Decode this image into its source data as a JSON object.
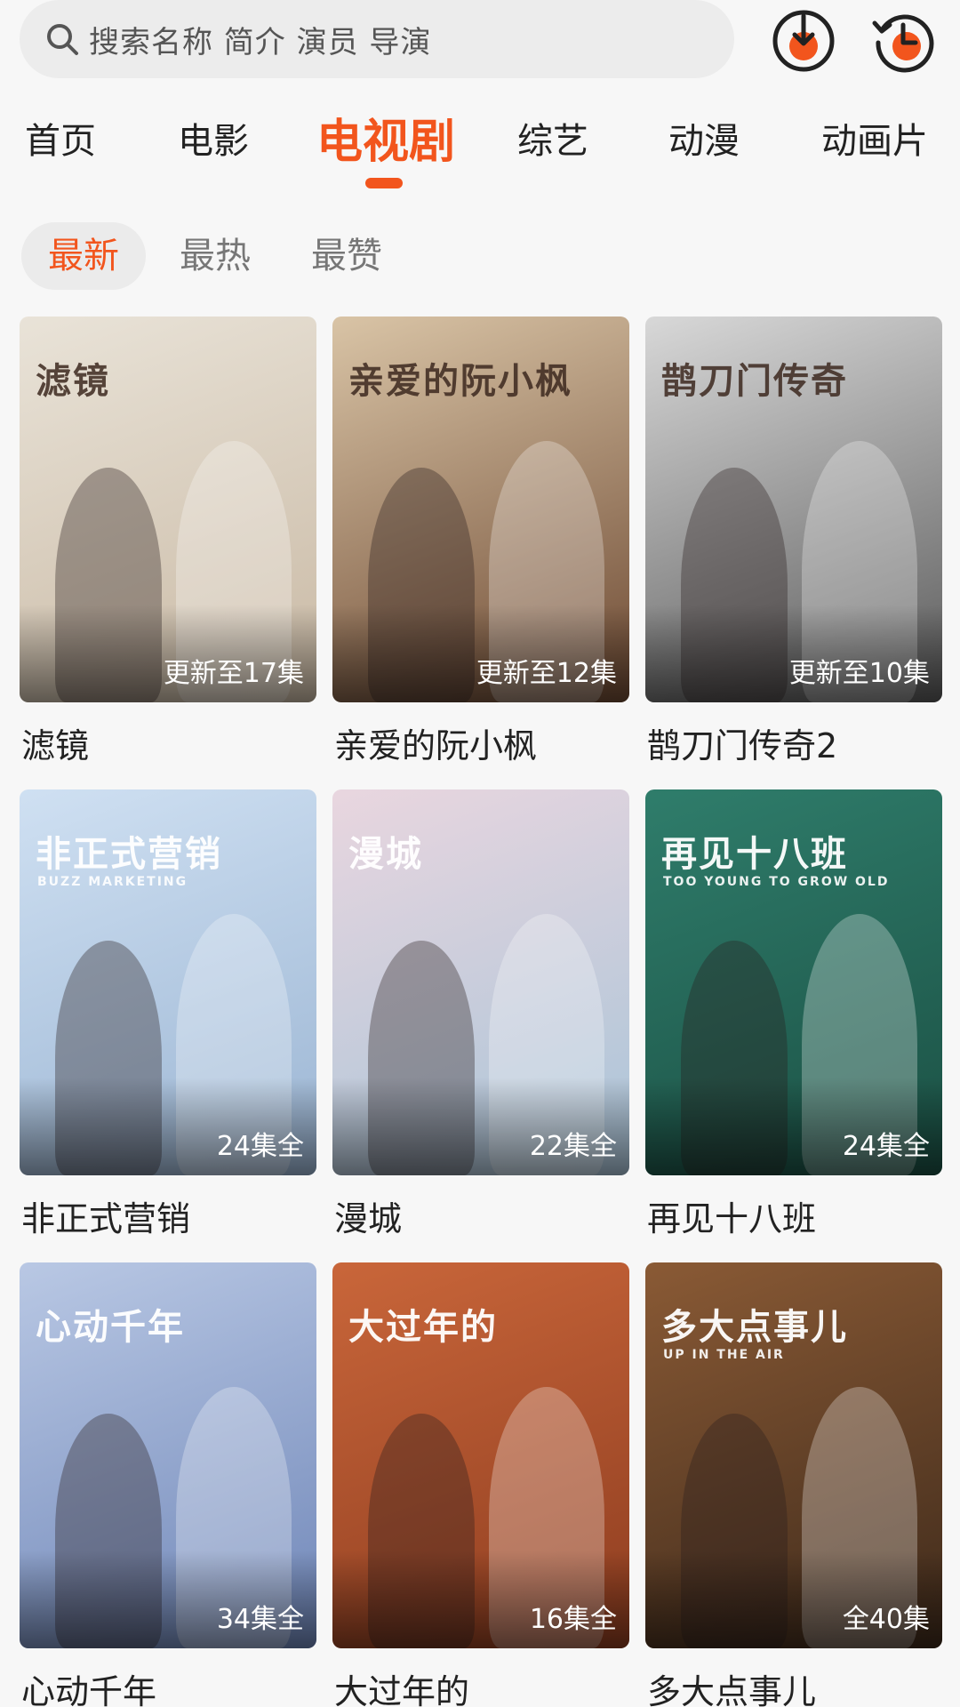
{
  "search": {
    "placeholder": "搜索名称 简介 演员 导演"
  },
  "header_icons": {
    "download": "download-icon",
    "history": "history-icon",
    "accent": "#f2551d"
  },
  "tabs": [
    {
      "label": "首页"
    },
    {
      "label": "电影"
    },
    {
      "label": "电视剧",
      "active": true
    },
    {
      "label": "综艺"
    },
    {
      "label": "动漫"
    },
    {
      "label": "动画片"
    }
  ],
  "filters": [
    {
      "label": "最新",
      "active": true
    },
    {
      "label": "最热"
    },
    {
      "label": "最赞"
    }
  ],
  "shows": [
    {
      "title": "滤镜",
      "badge": "更新至17集",
      "poster_text": "滤镜",
      "colors": [
        "#e9e3d8",
        "#c9b9a4"
      ]
    },
    {
      "title": "亲爱的阮小枫",
      "badge": "更新至12集",
      "poster_text": "亲爱的阮小枫",
      "colors": [
        "#d9c4a6",
        "#6e4a33"
      ]
    },
    {
      "title": "鹊刀门传奇2",
      "badge": "更新至10集",
      "poster_text": "鹊刀门传奇",
      "colors": [
        "#d8d8d8",
        "#5a5a5a"
      ]
    },
    {
      "title": "非正式营销",
      "badge": "24集全",
      "poster_text": "非正式营销",
      "poster_sub": "BUZZ MARKETING",
      "colors": [
        "#cfe0f2",
        "#9bb5d3"
      ]
    },
    {
      "title": "漫城",
      "badge": "22集全",
      "poster_text": "漫城",
      "colors": [
        "#e9d6df",
        "#a9c4d8"
      ]
    },
    {
      "title": "再见十八班",
      "badge": "24集全",
      "poster_text": "再见十八班",
      "poster_sub": "TOO YOUNG TO GROW OLD",
      "colors": [
        "#2f7d6b",
        "#1b5044"
      ]
    },
    {
      "title": "心动千年",
      "badge": "34集全",
      "poster_text": "心动千年",
      "colors": [
        "#b9c8e4",
        "#6f86b8"
      ]
    },
    {
      "title": "大过年的",
      "badge": "16集全",
      "poster_text": "大过年的",
      "colors": [
        "#c9663a",
        "#8e3d20"
      ]
    },
    {
      "title": "多大点事儿",
      "badge": "全40集",
      "poster_text": "多大点事儿",
      "poster_sub": "UP IN THE AIR",
      "colors": [
        "#8a5a35",
        "#3e2a1b"
      ]
    }
  ]
}
